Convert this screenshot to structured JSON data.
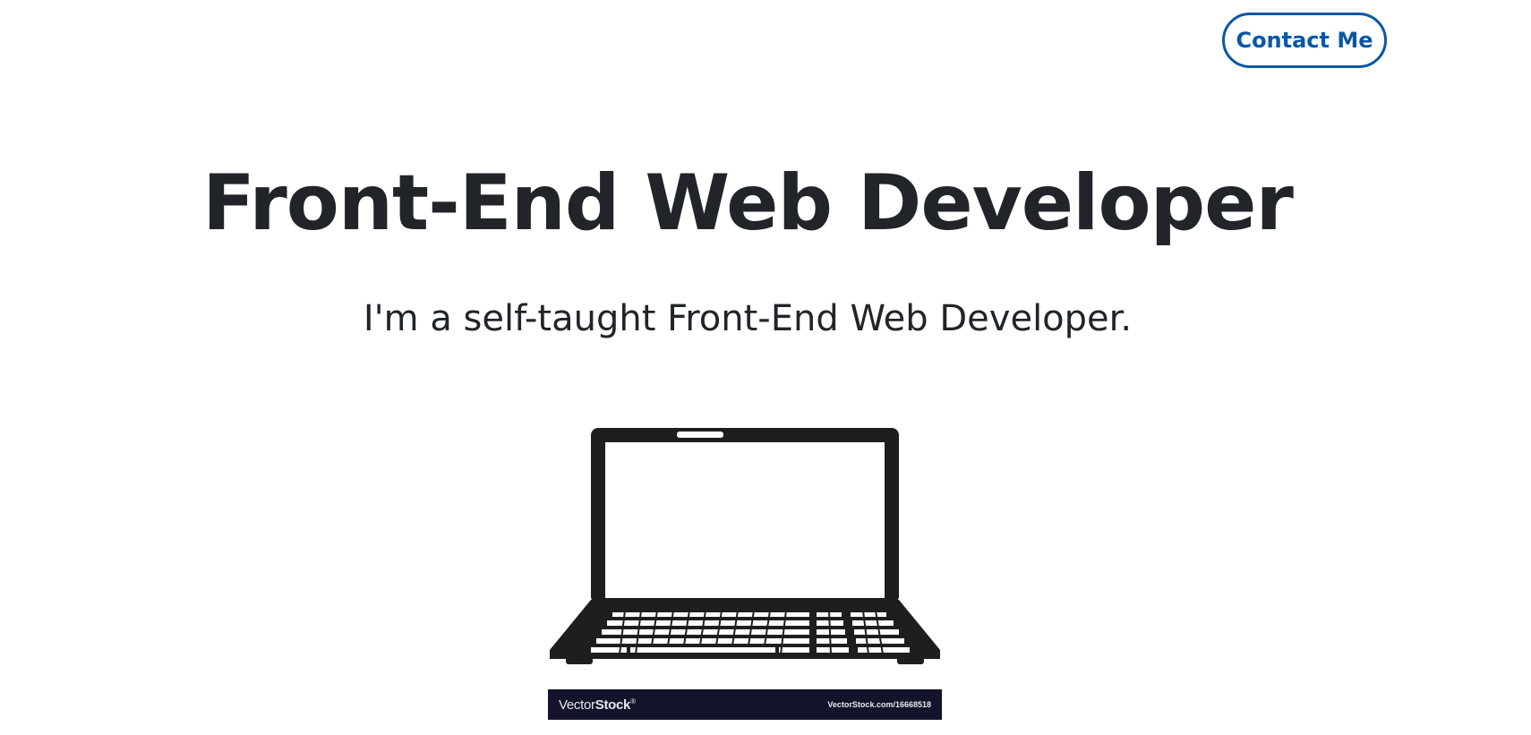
{
  "header": {
    "contact_label": "Contact Me"
  },
  "hero": {
    "title": "Front-End Web Developer",
    "subtitle": "I'm a self-taught Front-End Web Developer."
  },
  "image": {
    "watermark_logo_light": "Vector",
    "watermark_logo_bold": "Stock",
    "watermark_logo_mark": "®",
    "watermark_url": "VectorStock.com/16668518"
  },
  "colors": {
    "accent": "#0b57a4",
    "text": "#212529",
    "laptop": "#1e1e1e",
    "watermark_bg": "#13142a"
  }
}
